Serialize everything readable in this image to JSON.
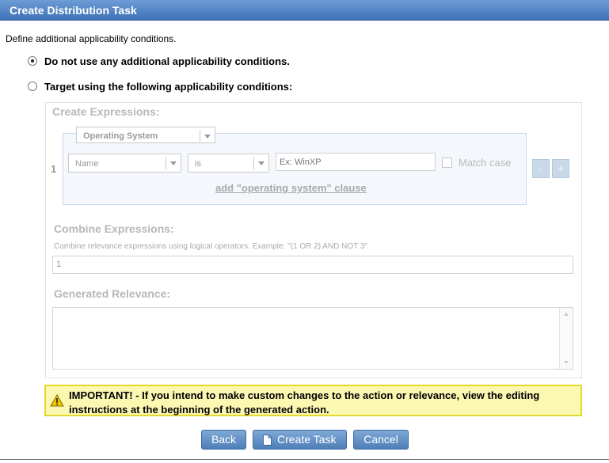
{
  "window": {
    "title": "Create Distribution Task"
  },
  "intro": "Define additional applicability conditions.",
  "options": [
    {
      "label": "Do not use any additional applicability conditions.",
      "selected": true
    },
    {
      "label": "Target using the following applicability conditions:",
      "selected": false
    }
  ],
  "create_expressions": {
    "heading": "Create Expressions:",
    "expressions": [
      {
        "index": "1",
        "category": "Operating System",
        "property": "Name",
        "operator": "is",
        "value_placeholder": "Ex: WinXP",
        "match_case_label": "Match case",
        "match_case_checked": false,
        "add_clause_link": "add \"operating system\" clause"
      }
    ],
    "remove_button": "-",
    "add_button": "+"
  },
  "combine_expressions": {
    "heading": "Combine Expressions:",
    "hint": "Combine relevance expressions using logical operators. Example: \"(1 OR 2) AND NOT 3\"",
    "value": "1"
  },
  "generated_relevance": {
    "heading": "Generated Relevance:",
    "value": ""
  },
  "warning": {
    "icon": "warning-icon",
    "text": "IMPORTANT! - If you intend to make custom changes to the action or relevance, view the editing instructions at the beginning of the generated action."
  },
  "buttons": {
    "back": "Back",
    "create": "Create Task",
    "cancel": "Cancel"
  },
  "colors": {
    "title_bar": "#4a7fc1",
    "warning_bg": "#fbf8b2",
    "warning_border": "#e6d72c",
    "button": "#5e8cc4"
  }
}
